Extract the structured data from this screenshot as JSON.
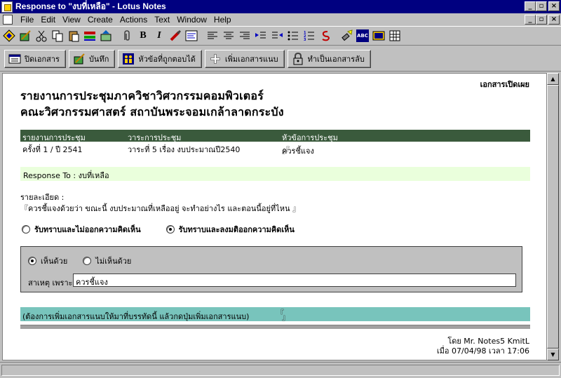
{
  "window": {
    "title": "Response to \"งบที่เหลือ\" - Lotus Notes",
    "controls": [
      "_",
      "▫",
      "×"
    ]
  },
  "menu": {
    "items": [
      "File",
      "Edit",
      "View",
      "Create",
      "Actions",
      "Text",
      "Window",
      "Help"
    ]
  },
  "toolbar": {
    "bold": "B",
    "italic": "I",
    "spell_label": "ABC"
  },
  "actions": {
    "close_doc": "ปิดเอกสาร",
    "save": "บันทึก",
    "answered_topic": "หัวข้อที่ถูกตอบได้",
    "add_attachment": "เพิ่มเอกสารแนบ",
    "make_private": "ทำเป็นเอกสารลับ"
  },
  "document": {
    "public_label": "เอกสารเปิดเผย",
    "heading_line1": "รายงานการประชุมภาควิชาวิศวกรรมคอมพิวเตอร์",
    "heading_line2": "คณะวิศวกรรมศาสตร์ สถาบันพระจอมเกล้าลาดกระบัง",
    "meta": {
      "col1_header": "รายงานการประชุม",
      "col2_header": "วาระการประชุม",
      "col3_header": "หัวข้อการประชุม",
      "col1_value": "ครั้งที่ 1 / ปี 2541",
      "col2_value": "วาระที่ 5 เรื่อง งบประมาณปี2540",
      "col3_value": "ควรชี้แจง"
    },
    "response_to": "Response To : งบที่เหลือ",
    "detail_label": "รายละเอียด :",
    "detail_text": "ควรชี้แจงด้วยว่า ขณะนี้ งบประมาณที่เหลืออยู่ จะทำอย่างไร และตอนนี้อยู่ที่ไหน",
    "acknowledge": {
      "option1": "รับทราบและไม่ออกความคิดเห็น",
      "option2": "รับทราบและลงมติออกความคิดเห็น",
      "selected": 2
    },
    "opinion": {
      "agree": "เห็นด้วย",
      "disagree": "ไม่เห็นด้วย",
      "selected": "agree",
      "reason_label": "สาเหตุ เพราะ",
      "reason_value": "ควรชี้แจง"
    },
    "attach_hint": "(ต้องการเพิ่มเอกสารแนบให้มาที่บรรทัดนี้ แล้วกดปุ่มเพิ่มเอกสารแนบ)",
    "author_line": "โดย Mr. Notes5 KmitL",
    "date_line": "เมื่อ 07/04/98 เวลา 17:06"
  }
}
